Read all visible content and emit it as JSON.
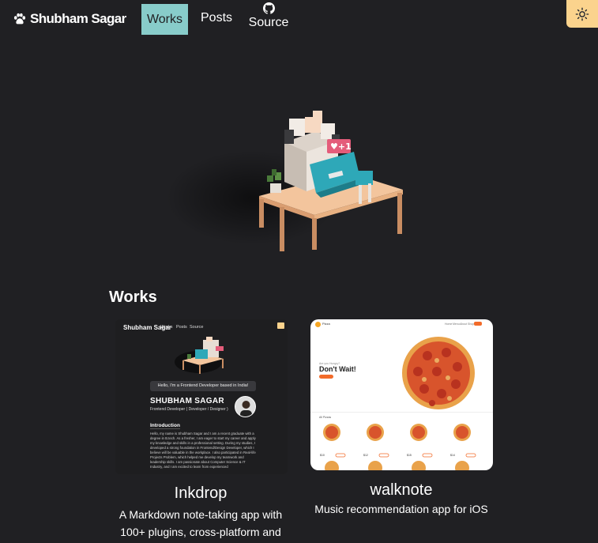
{
  "header": {
    "brand": "Shubham Sagar",
    "nav": [
      {
        "label": "Works",
        "active": true
      },
      {
        "label": "Posts",
        "active": false
      },
      {
        "label": "Source",
        "icon": "github-icon",
        "active": false
      }
    ],
    "theme_toggle_icon": "sun-icon"
  },
  "colors": {
    "background": "#202023",
    "nav_active": "#88ccca",
    "theme_toggle": "#fbd38d",
    "accent_teal": "#319795"
  },
  "hero": {
    "icon": "voxel-dog-at-desk-illustration"
  },
  "works": {
    "heading": "Works",
    "items": [
      {
        "title": "Inkdrop",
        "description": "A Markdown note-taking app with 100+ plugins, cross-platform and",
        "thumbnail": {
          "brand": "Shubham Sagar",
          "nav": [
            "Works",
            "Posts",
            "Source"
          ],
          "banner": "Hello, I'm a Frontend Developer based in India!",
          "name": "SHUBHAM SAGAR",
          "role": "Frontend Developer ( Developer / Designer )",
          "section": "Introduction",
          "paragraph": "Hello, my name is Shubham Sagar and I am a recent graduate with a degree in B.tech. As a fresher, I am eager to start my career and apply my knowledge and skills in a professional setting. During my studies, I developed a strong foundation in Frontend/Design Developer, which I believe will be valuable in the workplace. I also participated in Real-life Projects Problem, which helped me develop my teamwork and leadership skills. I am passionate about Computer Science & IT Industry, and I am excited to learn from experienced"
        }
      },
      {
        "title": "walknote",
        "description": "Music recommendation app for iOS",
        "thumbnail": {
          "logo": "Pizza",
          "nav": [
            "Home",
            "Menu",
            "About",
            "Shop"
          ],
          "tagline": "Are you Hungry?",
          "headline": "Don't Wait!",
          "section": "All Pizzas",
          "prices": [
            "$10",
            "$12",
            "$15",
            "$14"
          ]
        }
      }
    ]
  }
}
